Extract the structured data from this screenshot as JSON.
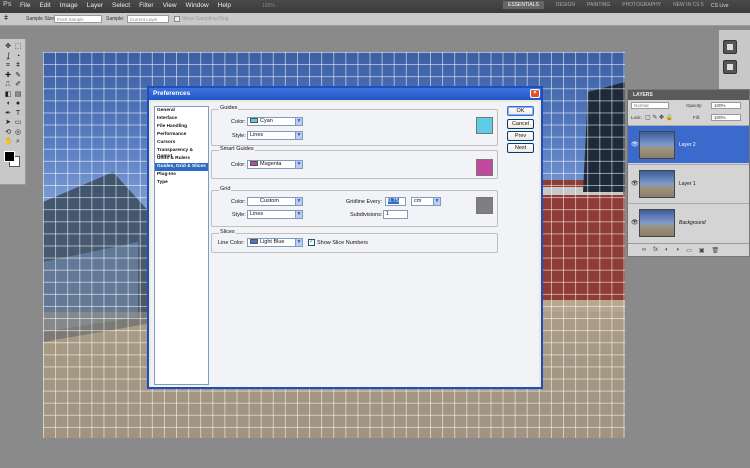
{
  "app": {
    "logo": "Ps",
    "menu": [
      "File",
      "Edit",
      "Image",
      "Layer",
      "Select",
      "Filter",
      "View",
      "Window",
      "Help"
    ],
    "zoom": "100%",
    "workspaces": [
      "ESSENTIALS",
      "DESIGN",
      "PAINTING",
      "PHOTOGRAPHY",
      "NEW IN CS 5"
    ],
    "cs_live": "CS Live"
  },
  "options_bar": {
    "sample_size_label": "Sample Size:",
    "sample_size_value": "Point Sample",
    "sample_label": "Sample:",
    "sample_value": "Current Layer",
    "show_ring_label": "Show Sampling Ring"
  },
  "tools": {
    "icons": [
      "move-icon",
      "marquee-icon",
      "lasso-icon",
      "quick-select-icon",
      "crop-icon",
      "eyedropper-icon",
      "healing-icon",
      "brush-icon",
      "stamp-icon",
      "history-brush-icon",
      "eraser-icon",
      "gradient-icon",
      "blur-icon",
      "dodge-icon",
      "pen-icon",
      "type-icon",
      "path-select-icon",
      "shape-icon",
      "3d-rotate-icon",
      "3d-orbit-icon",
      "hand-icon",
      "zoom-icon"
    ],
    "glyphs": [
      "✥",
      "⬚",
      "ʆ",
      "◔",
      "⌗",
      "ǂ",
      "✚",
      "✎",
      "⎍",
      "✐",
      "◧",
      "▤",
      "◖",
      "●",
      "✒",
      "T",
      "➤",
      "▭",
      "⟲",
      "◎",
      "✋",
      "⌕"
    ]
  },
  "layers_panel": {
    "title": "LAYERS",
    "blend_mode": "Normal",
    "opacity_label": "Opacity:",
    "opacity": "100%",
    "lock_label": "Lock:",
    "fill_label": "Fill:",
    "fill": "100%",
    "layers": [
      {
        "name": "Layer 2",
        "selected": true
      },
      {
        "name": "Layer 1",
        "selected": false
      },
      {
        "name": "Background",
        "selected": false
      }
    ],
    "footer_icons": [
      "∞",
      "fx",
      "◐",
      "◑",
      "▭",
      "▣",
      "🗑"
    ]
  },
  "preferences": {
    "title": "Preferences",
    "categories": [
      "General",
      "Interface",
      "File Handling",
      "Performance",
      "Cursors",
      "Transparency & Gamut",
      "Units & Rulers",
      "Guides, Grid & Slices",
      "Plug-Ins",
      "Type"
    ],
    "selected_category": 7,
    "buttons": {
      "ok": "OK",
      "cancel": "Cancel",
      "prev": "Prev",
      "next": "Next"
    },
    "guides": {
      "group_label": "Guides",
      "color_label": "Color:",
      "color_value": "Cyan",
      "color_hex": "#5ecce4",
      "style_label": "Style:",
      "style_value": "Lines"
    },
    "smart_guides": {
      "group_label": "Smart Guides",
      "color_label": "Color:",
      "color_value": "Magenta",
      "color_hex": "#c04aa0"
    },
    "grid": {
      "group_label": "Grid",
      "color_label": "Color:",
      "color_value": "Custom",
      "color_hex": "#7f7f7f",
      "style_label": "Style:",
      "style_value": "Lines",
      "gridline_label": "Gridline Every:",
      "gridline_value": "0.75",
      "gridline_unit": "cm",
      "subdivisions_label": "Subdivisions:",
      "subdivisions_value": "1"
    },
    "slices": {
      "group_label": "Slices",
      "line_color_label": "Line Color:",
      "line_color_value": "Light Blue",
      "line_color_hex": "#4a74c6",
      "show_numbers_label": "Show Slice Numbers",
      "show_numbers_checked": true
    }
  }
}
